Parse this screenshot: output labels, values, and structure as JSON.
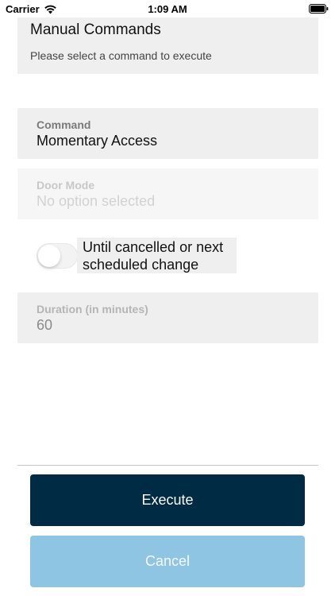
{
  "status_bar": {
    "carrier": "Carrier",
    "time": "1:09 AM"
  },
  "header": {
    "title": "Manual Commands",
    "subtitle": "Please select a command to execute"
  },
  "fields": {
    "command": {
      "label": "Command",
      "value": "Momentary Access"
    },
    "door_mode": {
      "label": "Door Mode",
      "placeholder": "No option selected"
    },
    "duration": {
      "label": "Duration (in minutes)",
      "value": "60"
    }
  },
  "toggle": {
    "label": "Until cancelled or next scheduled change",
    "on": false
  },
  "buttons": {
    "execute": "Execute",
    "cancel": "Cancel"
  },
  "colors": {
    "execute_bg": "#002b45",
    "cancel_bg": "#8ec5e2",
    "card_bg": "#efefef"
  }
}
